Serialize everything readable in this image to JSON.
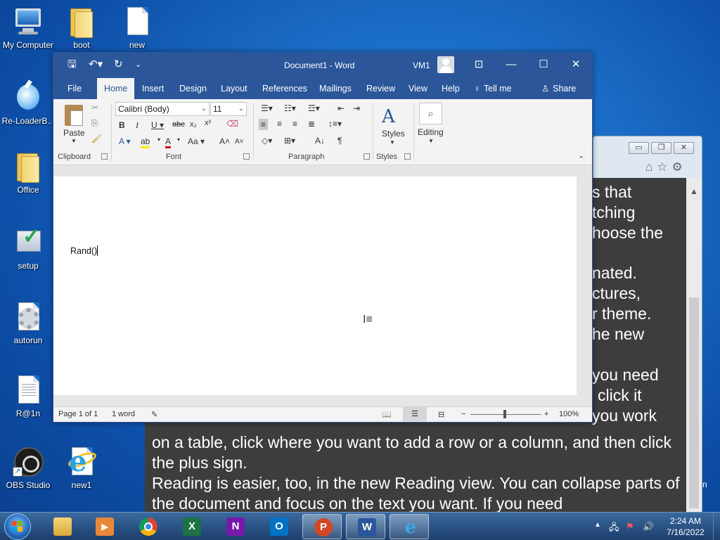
{
  "desktop": {
    "icons": [
      {
        "label": "My Computer"
      },
      {
        "label": "boot"
      },
      {
        "label": "new"
      },
      {
        "label": "Re-LoaderB..."
      },
      {
        "label": "Office"
      },
      {
        "label": "setup"
      },
      {
        "label": "autorun"
      },
      {
        "label": "R@1n"
      },
      {
        "label": "OBS Studio"
      },
      {
        "label": "new1"
      }
    ]
  },
  "background_window": {
    "text_fragments": [
      "s that",
      "tching",
      "hoose the",
      "nated.",
      "ctures,",
      "r theme.",
      "he new",
      "you need",
      "click it",
      "you work"
    ],
    "paragraph1": "on a table, click where you want to add a row or a column, and then click the plus sign.",
    "paragraph2": "Reading is easier, too, in the new Reading view. You can collapse parts of the document and focus on the text you want. If you need",
    "edge_char": "n"
  },
  "word": {
    "title": "Document1  -  Word",
    "user": "VM1",
    "tabs": [
      "File",
      "Home",
      "Insert",
      "Design",
      "Layout",
      "References",
      "Mailings",
      "Review",
      "View",
      "Help",
      "Tell me",
      "Share"
    ],
    "active_tab": "Home",
    "ribbon": {
      "paste_label": "Paste",
      "font_name": "Calibri (Body)",
      "font_size": "11",
      "styles_label": "Styles",
      "editing_label": "Editing",
      "groups": [
        "Clipboard",
        "Font",
        "Paragraph",
        "Styles"
      ]
    },
    "document_text": "Rand()",
    "status": {
      "page": "Page 1 of 1",
      "words": "1 word",
      "zoom": "100%"
    }
  },
  "taskbar": {
    "apps": [
      "Explorer",
      "Media Player",
      "Chrome",
      "Excel",
      "OneNote",
      "Outlook",
      "PowerPoint",
      "Word",
      "Internet Explorer"
    ],
    "clock_time": "2:24 AM",
    "clock_date": "7/16/2022"
  }
}
